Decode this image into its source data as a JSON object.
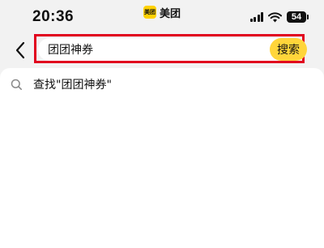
{
  "status_bar": {
    "time": "20:36",
    "brand_logo_text": "美团",
    "brand_name": "美团",
    "battery": "54",
    "icons": [
      "signal-icon",
      "wifi-icon",
      "battery-icon"
    ]
  },
  "search": {
    "back_icon": "chevron-left-icon",
    "query": "团团神券",
    "button_label": "搜索",
    "highlight_color": "#e1001e",
    "button_color": "#ffd53a"
  },
  "suggestions": [
    {
      "icon": "search-icon",
      "text": "查找\"团团神券\""
    }
  ]
}
